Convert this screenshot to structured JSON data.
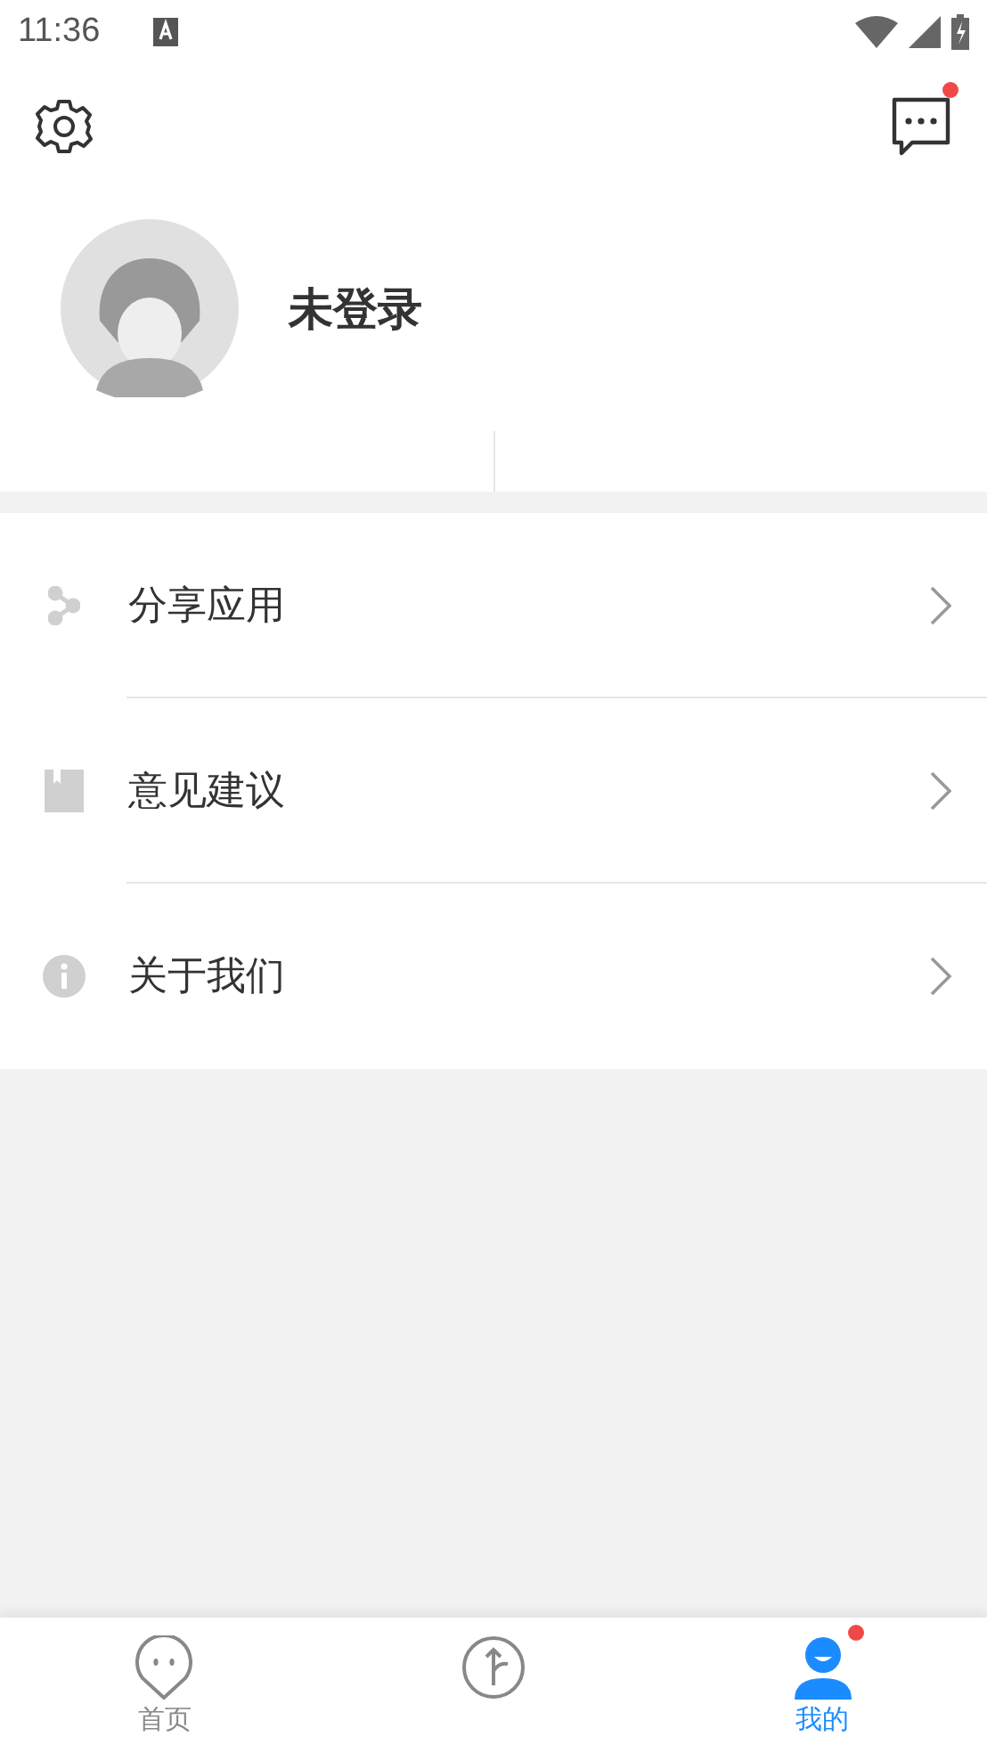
{
  "status_bar": {
    "time": "11:36"
  },
  "header": {
    "messages_unread": true
  },
  "profile": {
    "name": "未登录"
  },
  "menu": [
    {
      "kind": "share",
      "label": "分享应用"
    },
    {
      "kind": "feedback",
      "label": "意见建议"
    },
    {
      "kind": "about",
      "label": "关于我们"
    }
  ],
  "tabs": [
    {
      "kind": "home",
      "label": "首页",
      "selected": false,
      "badge": false
    },
    {
      "kind": "upload",
      "selected": false,
      "badge": false
    },
    {
      "kind": "me",
      "label": "我的",
      "selected": true,
      "badge": true
    }
  ]
}
